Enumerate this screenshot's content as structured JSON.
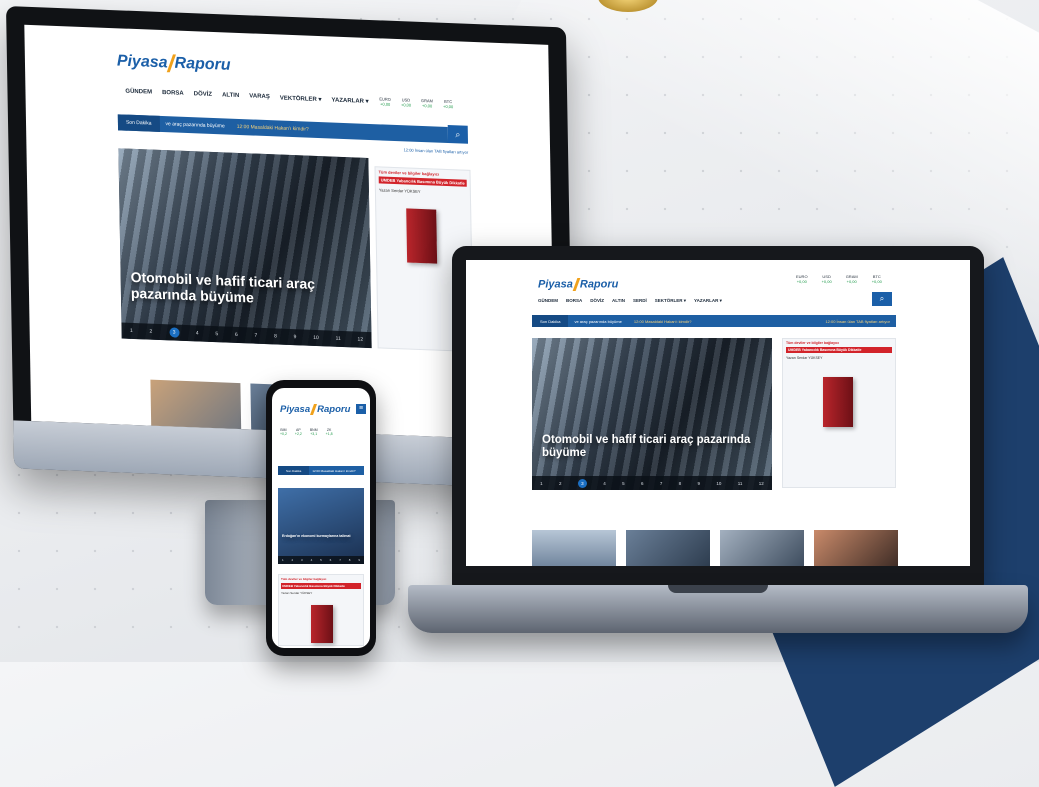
{
  "site": {
    "logo_part1": "Piyasa",
    "logo_part2": "Raporu",
    "nav": [
      "GÜNDEM",
      "BORSA",
      "DÖVİZ",
      "ALTIN",
      "VARAŞ",
      "VEKTÖRLER ▾",
      "YAZARLAR ▾"
    ],
    "laptop_nav": [
      "GÜNDEM",
      "BORSA",
      "DÖVİZ",
      "ALTIN",
      "SERDİ",
      "SEKTÖRLER ▾",
      "YAZARLAR ▾"
    ],
    "markets": [
      {
        "name": "EURO",
        "value": "+0,00"
      },
      {
        "name": "USD",
        "value": "+0,00"
      },
      {
        "name": "GRAM",
        "value": "+0,00"
      },
      {
        "name": "BTC",
        "value": "+0,00"
      }
    ],
    "news_label": "Son Dakika",
    "ticker": "ve araç pazarında büyüme",
    "ticker_2": "12:00 Masaldaki Hakan'ı kimdir?",
    "ticker_3": "12:00 İnsan ülan TAB fiyatları artıyor",
    "search_icon": "search-icon"
  },
  "hero": {
    "headline": "Otomobil ve hafif ticari araç pazarında büyüme",
    "pages": [
      "1",
      "2",
      "3",
      "4",
      "5",
      "6",
      "7",
      "8",
      "9",
      "10",
      "11",
      "12"
    ],
    "active_page": "3"
  },
  "ad": {
    "line1": "Tüm deviler ve bilgiler bağlayıcı",
    "line2": "UMDEB Yabancılık Basımına Büyük Dikkatle",
    "author": "Yazarı Serdar YÜKSEY"
  },
  "phone": {
    "markets": [
      {
        "name": "BIM",
        "value": "+0,2"
      },
      {
        "name": "AP",
        "value": "+2,2"
      },
      {
        "name": "BNM",
        "value": "+3,1"
      },
      {
        "name": "ZK",
        "value": "+1,8"
      }
    ],
    "news_label": "Son Dakika",
    "ticker": "12:00 Masaldaki Hakan'ı kimdir?",
    "headline": "Erdoğan'ın ekonomi kurmaylarına talimat",
    "pages": [
      "1",
      "2",
      "3",
      "4",
      "5",
      "6",
      "7",
      "8",
      "9"
    ]
  },
  "colors": {
    "brand": "#1b5fa8",
    "accent": "#f0a11b",
    "navy": "#1d3f6c",
    "alert": "#d2232a"
  }
}
